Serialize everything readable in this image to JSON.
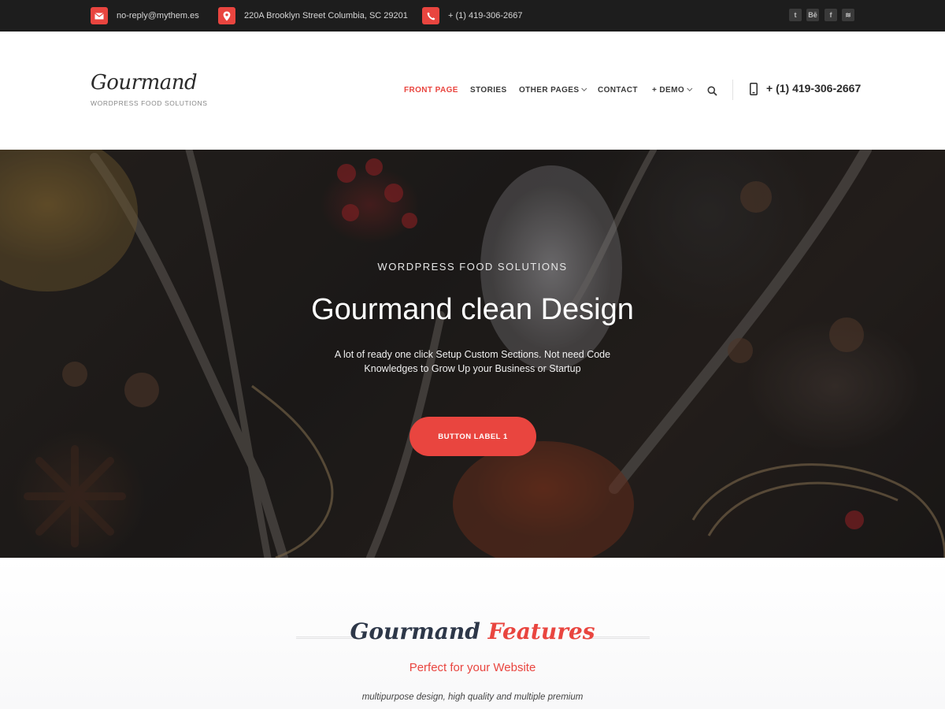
{
  "topbar": {
    "email": "no-reply@mythem.es",
    "address": "220A Brooklyn Street Columbia, SC 29201",
    "phone": "+ (1) 419-306-2667",
    "social": [
      {
        "name": "twitter-icon",
        "glyph": "t"
      },
      {
        "name": "behance-icon",
        "glyph": "Bē"
      },
      {
        "name": "facebook-icon",
        "glyph": "f"
      },
      {
        "name": "rss-icon",
        "glyph": "≋"
      }
    ],
    "accent": "#e9453f"
  },
  "header": {
    "logo": "Gourmand",
    "tagline": "WORDPRESS FOOD SOLUTIONS",
    "nav": [
      {
        "label": "FRONT PAGE",
        "active": true
      },
      {
        "label": "STORIES",
        "active": false
      },
      {
        "label": "OTHER PAGES",
        "active": false,
        "dropdown": true
      },
      {
        "label": "CONTACT",
        "active": false
      },
      {
        "label": "+ DEMO",
        "active": false,
        "dropdown": true
      }
    ],
    "phone": "+ (1) 419-306-2667"
  },
  "hero": {
    "kicker": "WORDPRESS FOOD SOLUTIONS",
    "title": "Gourmand clean Design",
    "description": "A lot of ready one click Setup Custom Sections. Not need Code Knowledges to Grow Up your Business or Startup",
    "button": "BUTTON LABEL 1"
  },
  "features": {
    "title_part1": "Gourmand",
    "title_part2": "Features",
    "subtitle": "Perfect for your Website",
    "description": "multipurpose design, high quality and multiple premium"
  }
}
